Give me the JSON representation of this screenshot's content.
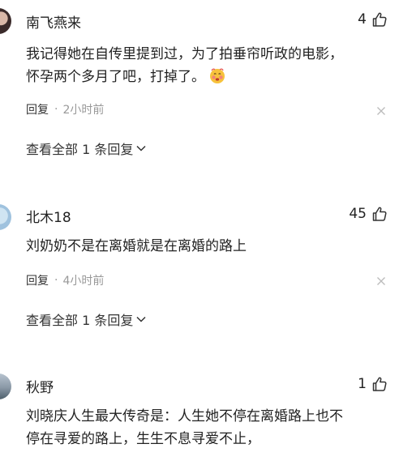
{
  "comments": [
    {
      "username": "南飞燕来",
      "likes": "4",
      "lines": [
        "我记得她在自传里提到过，为了拍垂帘听政的电影，",
        "怀孕两个多月了吧，打掉了。"
      ],
      "emoji": "hot-face-emoji",
      "reply": "回复",
      "dot": "·",
      "time": "2小时前",
      "view_all": "查看全部 1 条回复"
    },
    {
      "username": "北木18",
      "likes": "45",
      "lines": [
        "刘奶奶不是在离婚就是在离婚的路上"
      ],
      "reply": "回复",
      "dot": "·",
      "time": "4小时前",
      "view_all": "查看全部 1 条回复"
    },
    {
      "username": "秋野",
      "likes": "1",
      "lines": [
        "刘晓庆人生最大传奇是：人生她不停在离婚路上也不",
        "停在寻爱的路上，生生不息寻爱不止，"
      ]
    }
  ],
  "icons": {
    "like": "thumbs-up-icon",
    "close": "close-icon",
    "expand": "chevron-down-icon"
  },
  "colors": {
    "text": "#222222",
    "muted": "#999999",
    "background": "#ffffff"
  }
}
